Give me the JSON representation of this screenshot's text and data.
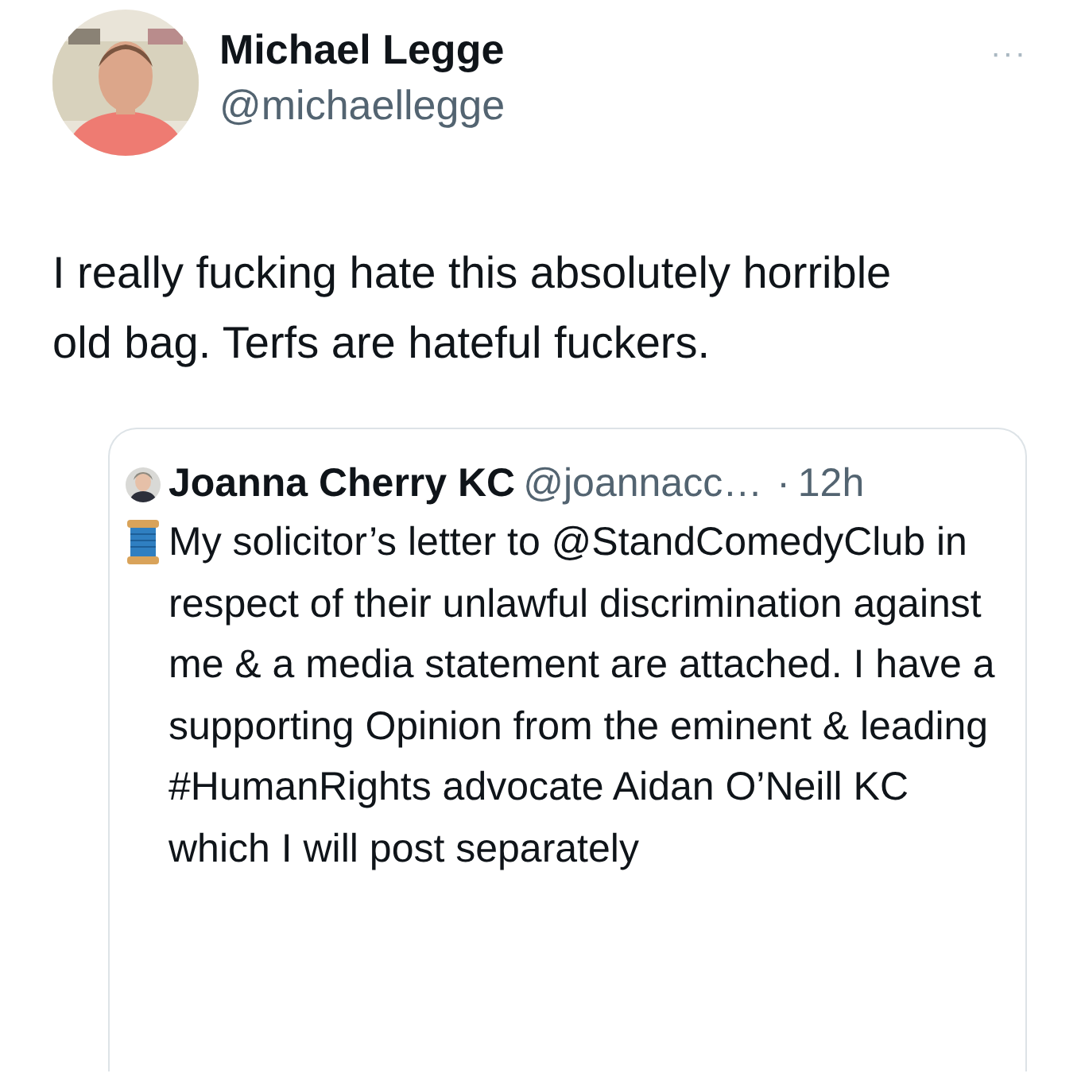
{
  "post": {
    "author_name": "Michael Legge",
    "author_handle": "@michaellegge",
    "more": "···",
    "text": "I really fucking hate this absolutely horrible old bag. Terfs are hateful fuckers."
  },
  "quoted_post": {
    "author_name": "Joanna Cherry KC",
    "author_handle": "@joannacc…",
    "separator": "·",
    "time": "12h",
    "text": "My solicitor’s letter to @StandComedyClub in respect of their unlawful discrimination against me & a media statement are attached. I have a supporting Opinion from the eminent & leading #HumanRights advocate Aidan O’Neill KC which I will post separately"
  }
}
